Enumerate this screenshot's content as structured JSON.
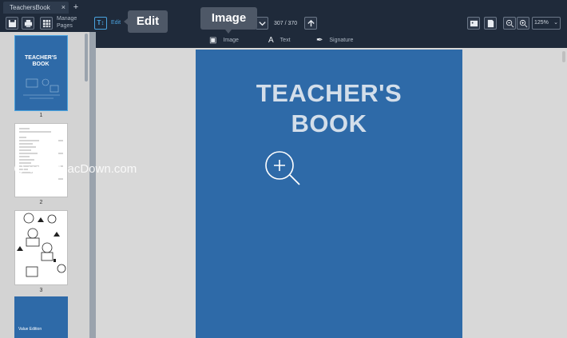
{
  "tab": {
    "title": "TeachersBook",
    "close": "×",
    "add": "+"
  },
  "toolbar": {
    "manage_pages_line1": "Manage",
    "manage_pages_line2": "Pages",
    "edit_label": "Edit",
    "page_indicator": "307 / 370",
    "zoom": "125%"
  },
  "tooltips": {
    "edit": "Edit",
    "image": "Image"
  },
  "subtoolbar": {
    "image_label": "Image",
    "text_label": "Text",
    "signature_label": "Signature",
    "text_glyph": "A"
  },
  "sidebar": {
    "thumbnails": [
      {
        "number": "1",
        "title": "TEACHER'S BOOK"
      },
      {
        "number": "2"
      },
      {
        "number": "3"
      }
    ],
    "thumb4_caption": "Value Edition"
  },
  "document": {
    "title_line1": "TEACHER'S",
    "title_line2": "BOOK"
  },
  "watermark": "www.MacDown.com",
  "colors": {
    "accent": "#4aa3df",
    "page_blue": "#2e6aa8",
    "toolbar": "#1f2a3a"
  }
}
